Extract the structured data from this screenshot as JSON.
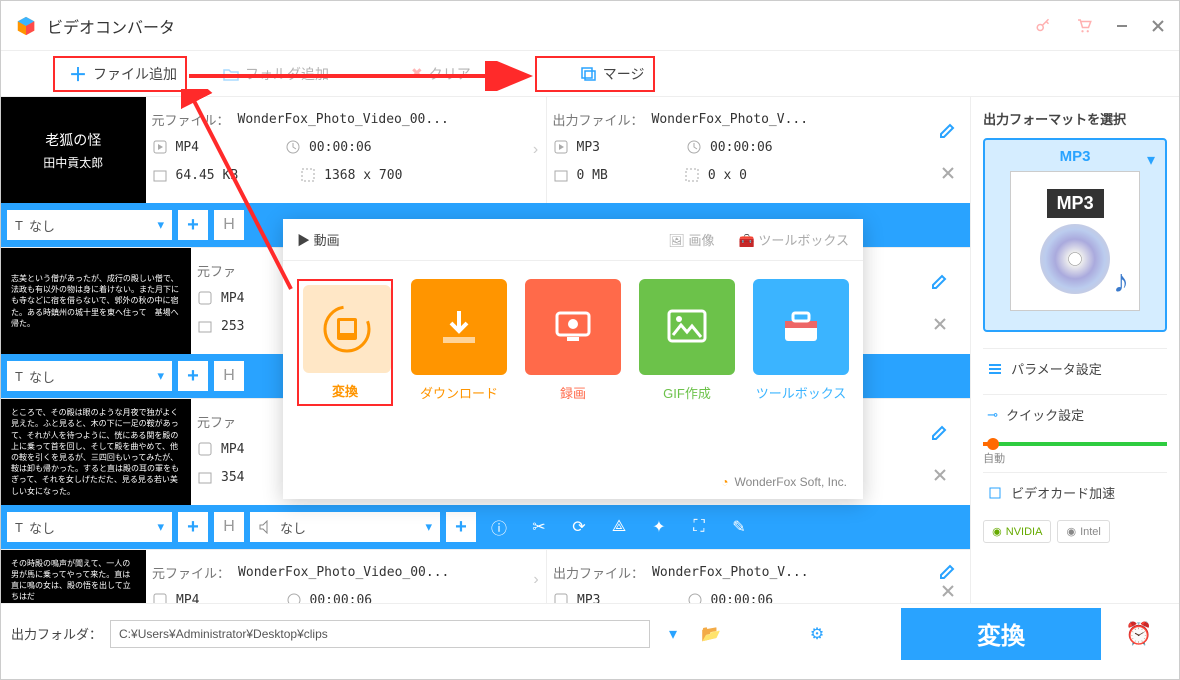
{
  "title": "ビデオコンバータ",
  "toolbar": {
    "add": "ファイル追加",
    "folder": "フォルダ追加",
    "clear": "クリア",
    "merge": "マージ"
  },
  "files": [
    {
      "thumb": {
        "t1": "老狐の怪",
        "t2": "田中貢太郎"
      },
      "src": {
        "label": "元ファイル：",
        "name": "WonderFox_Photo_Video_00...",
        "fmt": "MP4",
        "dur": "00:00:06",
        "size": "64.45 KB",
        "dim": "1368 x 700"
      },
      "out": {
        "label": "出力ファイル：",
        "name": "WonderFox_Photo_V...",
        "fmt": "MP3",
        "dur": "00:00:06",
        "size": "0 MB",
        "dim": "0 x 0"
      },
      "sub": "なし"
    },
    {
      "thumb": {
        "text": "志美という僧があったが、成行の殿しい僧で、法政も有以外の物は身に着けない。また月下にも寺などに宿を借らないで、郭外の秋の中に宿た。ある時鎮州の城十里を東へ住って　基場へ帰た。"
      },
      "src": {
        "label": "元ファ",
        "name": "",
        "fmt": "MP4",
        "dur": "",
        "size": "253",
        "dim": ""
      },
      "out": {
        "label": "",
        "name": "",
        "fmt": "",
        "dur": "",
        "size": "",
        "dim": ""
      },
      "sub": "なし"
    },
    {
      "thumb": {
        "text": "ところで、その殿は眼のような月夜で独がよく見えた。ふと見ると、木の下に一足の鞍があって、それが人を待つように、恍にある関を殿の上に乗って首を回し、そして殿を曲やめて、他の鞍を引くを見るが、三四回もいってみたが、鞍は卸も帰かった。すると直は殿の耳の軍をもぎって、それを女しげただた、見る見る若い美しい女になった。"
      },
      "src": {
        "label": "元ファ",
        "name": "",
        "fmt": "MP4",
        "dur": "",
        "size": "354",
        "dim": ""
      },
      "out": {
        "label": "",
        "name": "",
        "fmt": "",
        "dur": "",
        "size": "",
        "dim": ""
      },
      "sub": "なし",
      "audio": "なし"
    },
    {
      "thumb": {
        "text": "その時殿の鳴声が聞えて、一人の男が馬に乗ってやって来た。直は直に鳴の女は、殿の悟を出して立ちはだ"
      },
      "src": {
        "label": "元ファイル：",
        "name": "WonderFox_Photo_Video_00...",
        "fmt": "MP4",
        "dur": "00:00:06",
        "size": "",
        "dim": ""
      },
      "out": {
        "label": "出力ファイル：",
        "name": "WonderFox_Photo_V...",
        "fmt": "MP3",
        "dur": "00:00:06",
        "size": "",
        "dim": ""
      }
    }
  ],
  "right": {
    "title": "出力フォーマットを選択",
    "fmt": "MP3",
    "param": "パラメータ設定",
    "quick": "クイック設定",
    "auto": "自動",
    "gpu": "ビデオカード加速",
    "nvidia": "NVIDIA",
    "intel": "Intel"
  },
  "bottom": {
    "label": "出力フォルダ：",
    "path": "C:¥Users¥Administrator¥Desktop¥clips",
    "convert": "変換"
  },
  "popup": {
    "tabs": {
      "video": "動画",
      "image": "画像",
      "tools": "ツールボックス"
    },
    "cards": {
      "conv": "変換",
      "dl": "ダウンロード",
      "rec": "録画",
      "gif": "GIF作成",
      "tool": "ツールボックス"
    },
    "footer": "WonderFox Soft, Inc."
  }
}
